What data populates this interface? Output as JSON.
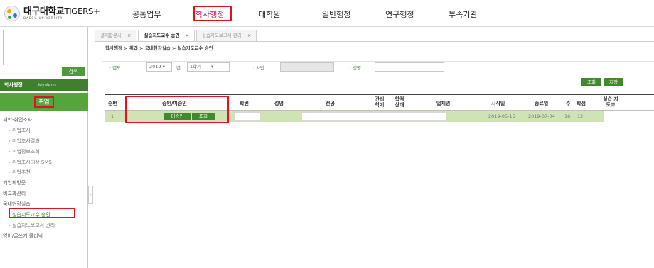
{
  "header": {
    "logo_text": "대구대학교",
    "logo_suffix": "TIGERS+",
    "logo_sub": "DAEGU UNIVERSITY",
    "menu": [
      "공통업무",
      "학사행정",
      "대학원",
      "일반행정",
      "연구행정",
      "부속기관"
    ],
    "active_menu": "학사행정"
  },
  "sidebar": {
    "search_button": "검색",
    "section_title": "학사행정",
    "section_sub": "MyMenu",
    "active_group": "취업",
    "items": [
      {
        "label": "재학-취업조사",
        "level": 0
      },
      {
        "label": "취업조사",
        "level": 1
      },
      {
        "label": "취업조사결과",
        "level": 1
      },
      {
        "label": "취업정보조회",
        "level": 1
      },
      {
        "label": "취업조사대상 SMS",
        "level": 1
      },
      {
        "label": "취업추천",
        "level": 1
      },
      {
        "label": "기업체방문",
        "level": 0
      },
      {
        "label": "비교과관리",
        "level": 0
      },
      {
        "label": "국내현장실습",
        "level": 0
      },
      {
        "label": "실습지도교수 승인",
        "level": 1,
        "current": true
      },
      {
        "label": "실습지도보고서 관리",
        "level": 1
      },
      {
        "label": "영어/글쓰기 클리닉",
        "level": 0
      }
    ]
  },
  "tabs": [
    {
      "label": "결재함문서",
      "active": false
    },
    {
      "label": "실습지도교수 승인",
      "active": true
    },
    {
      "label": "실습지도보고서 관리",
      "active": false
    }
  ],
  "tab_close": "×",
  "breadcrumb": "학사행정 > 취업 > 국내현장실습 > 실습지도교수 승인",
  "filter": {
    "year_label": "년도",
    "year_value": "2019 ▾",
    "year_unit": "년",
    "semester_value": "1학기",
    "semester_caret": "▾",
    "id_label": "사번",
    "name_label": "성명"
  },
  "buttons": {
    "search": "조회",
    "save": "저장"
  },
  "grid": {
    "headers": [
      "순번",
      "승인/미승인",
      "학번",
      "성명",
      "전공",
      "관리 학기",
      "학적 상태",
      "업체명",
      "시작일",
      "종료일",
      "주",
      "학점",
      "실습 지도교"
    ],
    "rows": [
      {
        "no": "1",
        "unapprove_btn": "미승인",
        "view_btn": "조회",
        "start": "2019-05-15",
        "end": "2019-07-04",
        "weeks": "16",
        "credits": "12"
      }
    ]
  },
  "colors": {
    "accent_green": "#3f8a2e",
    "highlight_red": "#e0141e",
    "row_bg": "#cfe3b5"
  }
}
